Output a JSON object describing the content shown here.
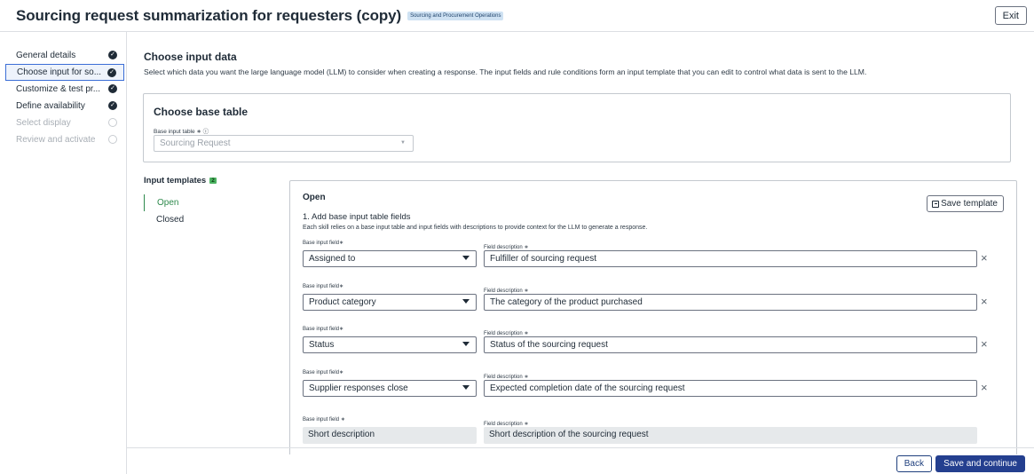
{
  "header": {
    "title": "Sourcing request summarization for requesters (copy)",
    "badge": "Sourcing and Procurement Operations",
    "exit_label": "Exit"
  },
  "steps": [
    {
      "label": "General details",
      "state": "done"
    },
    {
      "label": "Choose input for so...",
      "state": "done"
    },
    {
      "label": "Customize & test pr...",
      "state": "done"
    },
    {
      "label": "Define availability",
      "state": "done"
    },
    {
      "label": "Select display",
      "state": "todo"
    },
    {
      "label": "Review and activate",
      "state": "todo"
    }
  ],
  "main": {
    "heading": "Choose input data",
    "description": "Select which data you want the large language model (LLM) to consider when creating a response. The input fields and rule conditions form an input template that you can edit to control what data is sent to the LLM."
  },
  "base_table": {
    "title": "Choose base table",
    "field_label": "Base input table ∗ ⓘ",
    "value": "Sourcing Request"
  },
  "templates": {
    "label": "Input templates",
    "count": "2",
    "tabs": [
      "Open",
      "Closed"
    ]
  },
  "panel": {
    "title": "Open",
    "save_label": "Save template",
    "section": "1. Add base input table fields",
    "section_desc": "Each skill relies on a base input table and input fields with descriptions to provide context for the LLM to generate a response.",
    "base_field_label": "Base input field∗",
    "readonly_field_label": "Base input field ∗",
    "desc_label": "Field description ∗",
    "rows": [
      {
        "field": "Assigned to",
        "desc": "Fulfiller of sourcing request"
      },
      {
        "field": "Product category",
        "desc": "The category of the product purchased"
      },
      {
        "field": "Status",
        "desc": "Status of the sourcing request"
      },
      {
        "field": "Supplier responses close",
        "desc": "Expected completion date of the sourcing request"
      }
    ],
    "readonly_row": {
      "field": "Short description",
      "desc": "Short description of the sourcing request"
    }
  },
  "footer": {
    "back_label": "Back",
    "continue_label": "Save and continue"
  },
  "colors": {
    "accent": "#243f8f",
    "active_tab": "#2f8a4d",
    "count_badge": "#4cb361"
  }
}
